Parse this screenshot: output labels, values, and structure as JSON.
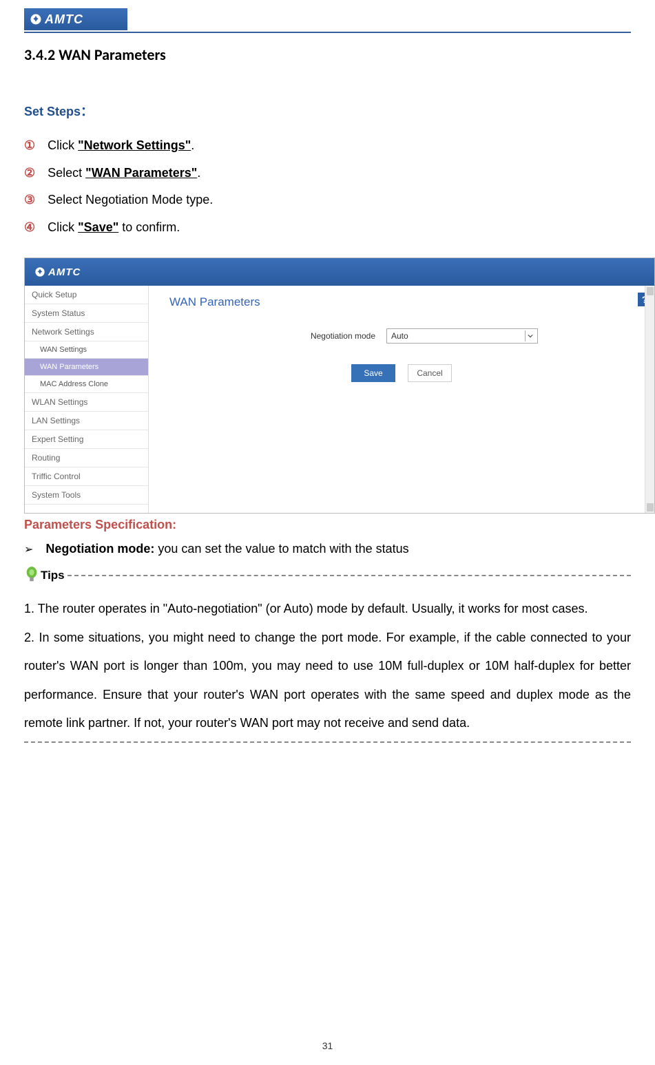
{
  "logo_text": "AMTC",
  "section_heading": "3.4.2 WAN Parameters",
  "set_steps_label": "Set Steps：",
  "steps": [
    {
      "num": "①",
      "prefix": "Click ",
      "bold": "\"Network Settings\"",
      "suffix": "."
    },
    {
      "num": "②",
      "prefix": "Select ",
      "bold": "\"WAN Parameters\"",
      "suffix": "."
    },
    {
      "num": "③",
      "prefix": "Select Negotiation Mode type.",
      "bold": "",
      "suffix": ""
    },
    {
      "num": "④",
      "prefix": "Click ",
      "bold": "\"Save\"",
      "suffix": " to confirm."
    }
  ],
  "screenshot": {
    "logo": "AMTC",
    "title": "WAN Parameters",
    "sidebar": {
      "items": [
        {
          "label": "Quick Setup",
          "type": "top"
        },
        {
          "label": "System Status",
          "type": "top"
        },
        {
          "label": "Network Settings",
          "type": "top"
        },
        {
          "label": "WAN Settings",
          "type": "sub"
        },
        {
          "label": "WAN Parameters",
          "type": "sub-active"
        },
        {
          "label": "MAC Address Clone",
          "type": "sub"
        },
        {
          "label": "WLAN Settings",
          "type": "top"
        },
        {
          "label": "LAN Settings",
          "type": "top"
        },
        {
          "label": "Expert Setting",
          "type": "top"
        },
        {
          "label": "Routing",
          "type": "top"
        },
        {
          "label": "Triffic Control",
          "type": "top"
        },
        {
          "label": "System Tools",
          "type": "top"
        }
      ]
    },
    "form": {
      "label": "Negotiation mode",
      "value": "Auto"
    },
    "buttons": {
      "save": "Save",
      "cancel": "Cancel"
    },
    "help": "?"
  },
  "param_spec_label": "Parameters Specification:",
  "param_bullet": {
    "symbol": "➢",
    "bold": "Negotiation mode:",
    "text": " you can set the value to match with the status"
  },
  "tips_label": "Tips",
  "tips": {
    "p1": "1. The router operates in \"Auto-negotiation\" (or Auto) mode by default. Usually, it works for most cases.",
    "p2": "2. In some situations, you might need to change the port mode. For example, if the cable connected to your router's WAN port is longer than 100m, you may need to use 10M full-duplex or 10M half-duplex for better performance. Ensure that your router's WAN port operates with the same speed and duplex mode as the remote link partner. If not, your router's WAN port may not receive and send data."
  },
  "page_number": "31"
}
